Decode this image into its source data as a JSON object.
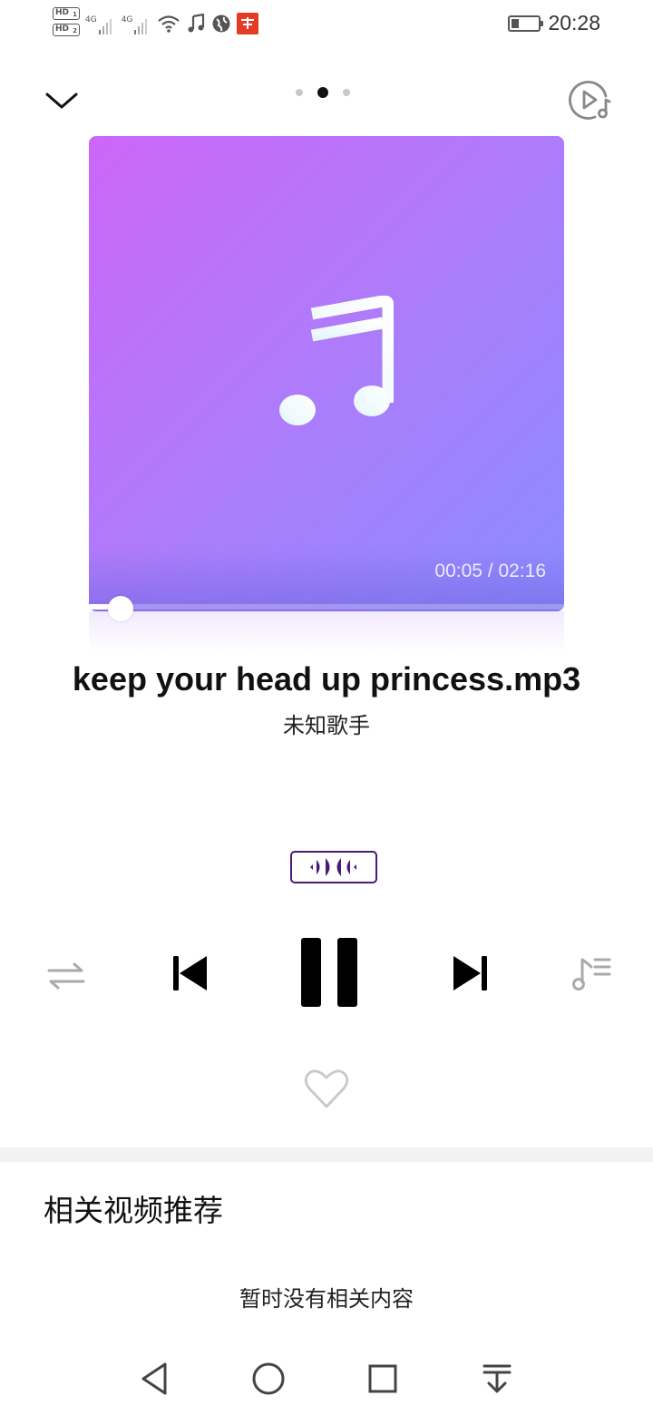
{
  "status_bar": {
    "sim1_label": "HD",
    "sim1_index": "1",
    "sim2_label": "HD",
    "sim2_index": "2",
    "network1": "4G",
    "network2": "4G",
    "battery_level": 0.3,
    "time": "20:28",
    "icons": [
      "signal-icon",
      "signal-icon",
      "wifi-icon",
      "music-note-icon",
      "globe-icon",
      "app-notification-icon"
    ]
  },
  "header": {
    "page_dots": 3,
    "active_page": 1
  },
  "player": {
    "current_time": "00:05",
    "duration": "02:16",
    "time_display": "00:05 / 02:16",
    "progress": 0.04,
    "song_title": "keep your head up princess.mp3",
    "artist": "未知歌手",
    "state": "playing"
  },
  "controls": [
    "repeat-icon",
    "previous-icon",
    "pause-icon",
    "next-icon",
    "playlist-icon"
  ],
  "colors": {
    "art_gradient_start": "#cc66f9",
    "art_gradient_end": "#8b8cff",
    "effect_badge": "#4a1a7a"
  },
  "related": {
    "title": "相关视频推荐",
    "empty_message": "暂时没有相关内容"
  },
  "nav": [
    "back-icon",
    "home-icon",
    "recents-icon",
    "notification-pull-icon"
  ]
}
